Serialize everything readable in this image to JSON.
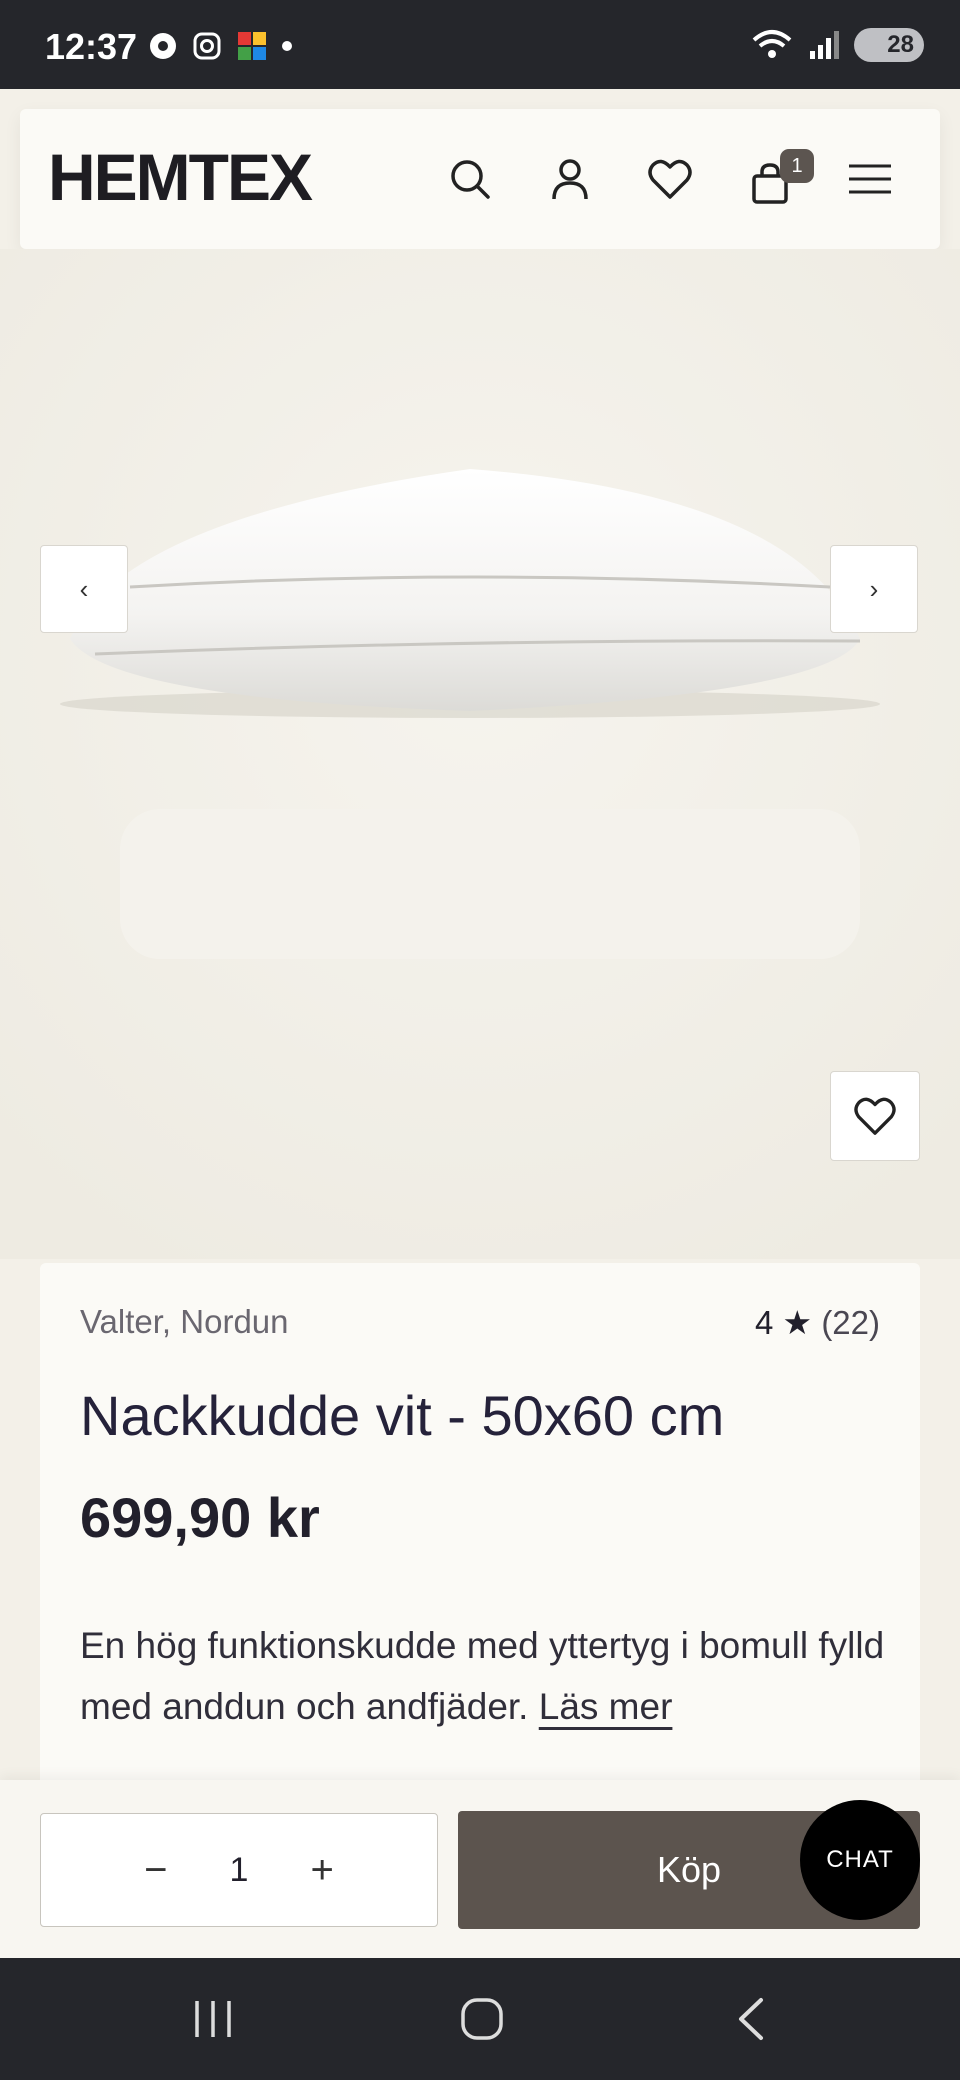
{
  "status_bar": {
    "time": "12:37",
    "battery": "28"
  },
  "header": {
    "logo": "HEMTEX",
    "cart_count": "1"
  },
  "gallery": {
    "prev_label": "‹",
    "next_label": "›"
  },
  "product": {
    "brand": "Valter, Nordun",
    "rating_score": "4 ★",
    "rating_count": "(22)",
    "title": "Nackkudde vit - 50x60 cm",
    "price": "699,90 kr",
    "description": "En hög funktionskudde med yttertyg i bomull fylld med anddun och andfjäder.",
    "read_more": "Läs mer"
  },
  "buy_bar": {
    "qty_minus": "−",
    "qty_value": "1",
    "qty_plus": "+",
    "buy_label": "Köp",
    "chat_label": "CHAT"
  },
  "colors": {
    "accent": "#5c544e",
    "header_bg": "#fbfaf6",
    "page_bg": "#f3f0e8"
  }
}
